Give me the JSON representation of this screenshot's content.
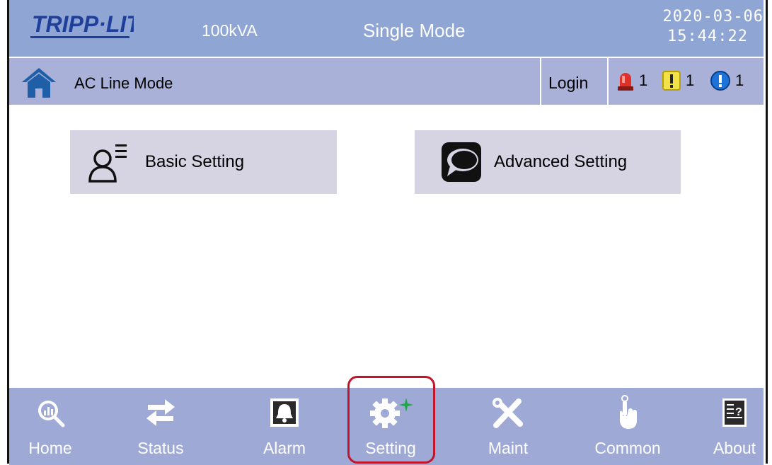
{
  "header": {
    "brand": "TRIPP·LITE",
    "capacity": "100kVA",
    "mode": "Single Mode",
    "date": "2020-03-06",
    "time": "15:44:22"
  },
  "status_bar": {
    "line_mode": "AC Line Mode",
    "login_label": "Login",
    "alarms": [
      {
        "icon": "red-siren-icon",
        "count": "1",
        "color": "#e0302a"
      },
      {
        "icon": "yellow-warning-icon",
        "count": "1",
        "color": "#f1e24a"
      },
      {
        "icon": "blue-info-icon",
        "count": "1",
        "color": "#1e73d8"
      }
    ]
  },
  "main": {
    "buttons": [
      {
        "label": "Basic Setting",
        "icon": "user-list-icon"
      },
      {
        "label": "Advanced Setting",
        "icon": "speech-bubble-icon"
      }
    ]
  },
  "nav": {
    "active": "Setting",
    "highlight_color": "#c0162b",
    "items": [
      {
        "label": "Home",
        "icon": "home-chart-icon"
      },
      {
        "label": "Status",
        "icon": "arrows-exchange-icon"
      },
      {
        "label": "Alarm",
        "icon": "bell-icon"
      },
      {
        "label": "Setting",
        "icon": "gear-icon"
      },
      {
        "label": "Maint",
        "icon": "tools-icon"
      },
      {
        "label": "Common",
        "icon": "touch-hand-icon"
      },
      {
        "label": "About",
        "icon": "help-document-icon"
      }
    ]
  },
  "colors": {
    "topbar": "#8fa6d4",
    "subbar": "#a9b1d9",
    "bottombar": "#9fa9d6",
    "button_bg": "#d6d3e3"
  }
}
